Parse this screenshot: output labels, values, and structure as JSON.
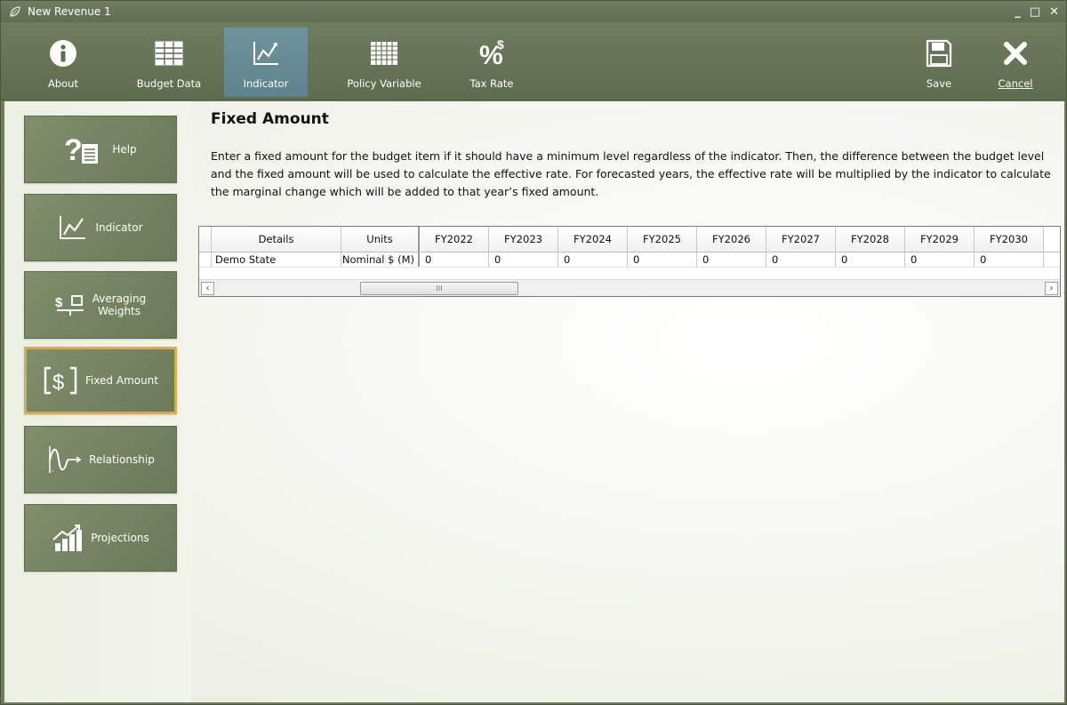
{
  "window": {
    "title": "New Revenue 1",
    "controls": [
      "_",
      "□",
      "✕"
    ]
  },
  "toolbar": {
    "about": "About",
    "budget_data": "Budget Data",
    "indicator": "Indicator",
    "policy_variable": "Policy Variable",
    "tax_rate": "Tax Rate",
    "save": "Save",
    "cancel": "Cancel"
  },
  "sidebar": {
    "help": "Help",
    "indicator": "Indicator",
    "averaging_weights_1": "Averaging",
    "averaging_weights_2": "Weights",
    "fixed_amount": "Fixed Amount",
    "relationship": "Relationship",
    "projections": "Projections"
  },
  "main": {
    "title": "Fixed Amount",
    "description": "Enter a fixed amount for the budget item if it should have a minimum level regardless of the indicator. Then, the difference between the budget level and the fixed amount will be used to calculate the effective rate. For forecasted years, the effective rate will be multiplied by the indicator to calculate the marginal change which will be added to that year’s fixed amount."
  },
  "grid": {
    "headers": [
      "Details",
      "Units",
      "FY2022",
      "FY2023",
      "FY2024",
      "FY2025",
      "FY2026",
      "FY2027",
      "FY2028",
      "FY2029",
      "FY2030"
    ],
    "row": [
      "Demo State",
      "Nominal $ (M)",
      "0",
      "0",
      "0",
      "0",
      "0",
      "0",
      "0",
      "0",
      "0"
    ],
    "scroll_grip": "III"
  },
  "colors": {
    "accent": "#6b8f99",
    "selected_border": "#d9aa52",
    "chrome": "#6d7c5d"
  }
}
